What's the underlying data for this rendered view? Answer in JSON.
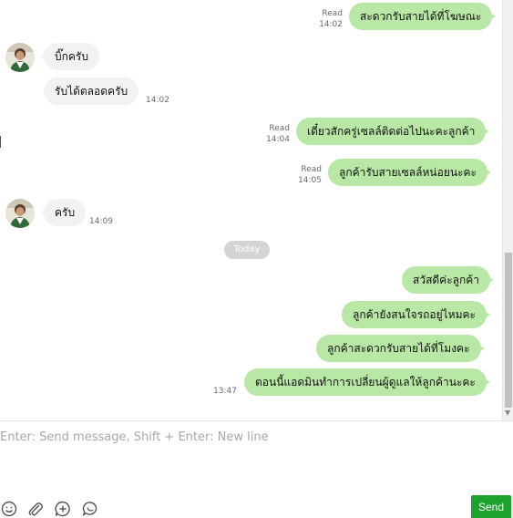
{
  "chat": {
    "messages": [
      {
        "text": "สะดวกรับสายได้ที่โฆษณะ",
        "status": "Read",
        "time": "14:02"
      },
      {
        "text": "บิ๊กครับ"
      },
      {
        "text": "รับได้ตลอดครับ",
        "time": "14:02"
      },
      {
        "text": "เดี๋ยวสักครู่เซลล์ติดต่อไปนะคะลูกค้า",
        "status": "Read",
        "time": "14:04"
      },
      {
        "text": "ลูกค้ารับสายเซลล์หน่อยนะคะ",
        "status": "Read",
        "time": "14:05"
      },
      {
        "text": "ครับ",
        "time": "14:09"
      },
      {
        "text": "สวัสดีค่ะลูกค้า"
      },
      {
        "text": "ลูกค้ายังสนใจรถอยู่ไหมคะ"
      },
      {
        "text": "ลูกค้าสะดวกรับสายได้ที่โมงคะ"
      },
      {
        "text": "ตอนนี้แอดมินทำการเปลี่ยนผู้ดูแลให้ลูกค้านะคะ",
        "time": "13:47"
      }
    ],
    "date_separator": "Today"
  },
  "composer": {
    "placeholder": "Enter: Send message, Shift + Enter: New line",
    "send_label": "Send",
    "tools": [
      "emoji-icon",
      "paperclip-icon",
      "plus-circle-icon",
      "chat-bubble-icon"
    ]
  },
  "colors": {
    "outgoing_bubble": "#b9e7a6",
    "incoming_bubble": "#f1f2f4",
    "send_button": "#1ea22f",
    "date_pill": "#d4d4d4"
  }
}
